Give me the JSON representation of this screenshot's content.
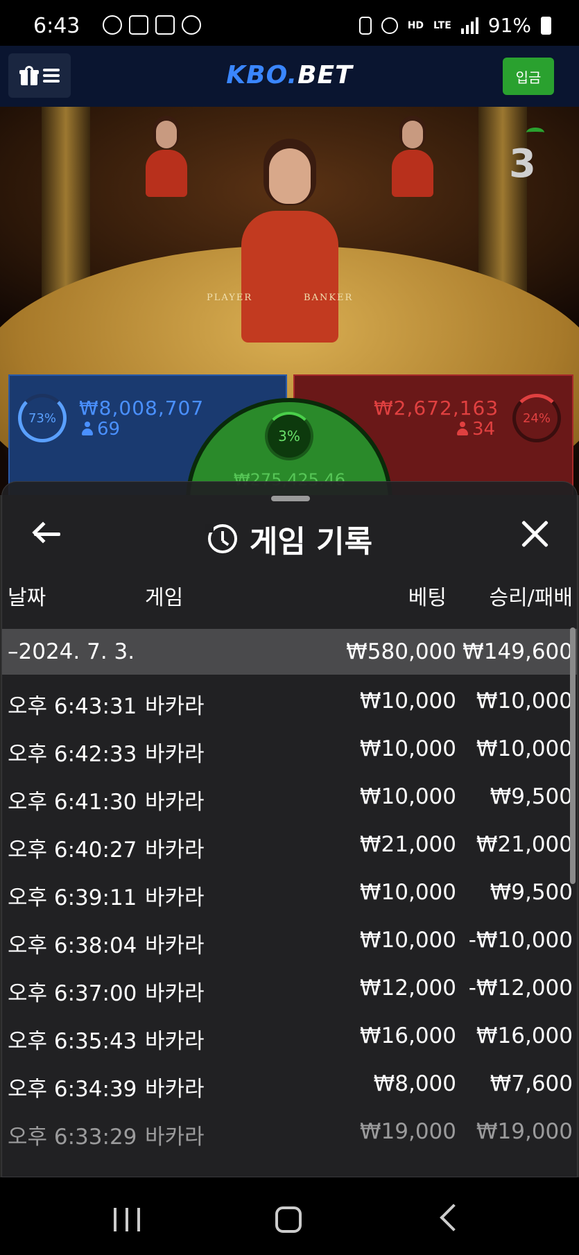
{
  "status_bar": {
    "time": "6:43",
    "hd": "HD",
    "voice": "VoLTE",
    "lte": "LTE",
    "battery": "91%"
  },
  "header": {
    "logo_main": "KBO.",
    "logo_accent": "BET",
    "deposit_label": "입금",
    "accent_color": "#3a86ff",
    "deposit_color": "#2aa12f"
  },
  "game": {
    "round_number": "3",
    "table_player_label": "PLAYER",
    "table_banker_label": "BANKER",
    "player": {
      "percent": "73%",
      "amount": "₩8,008,707",
      "count": "69"
    },
    "banker": {
      "percent": "24%",
      "amount": "₩2,672,163",
      "count": "34"
    },
    "tie": {
      "percent": "3%",
      "amount": "₩275,425.46"
    }
  },
  "sheet": {
    "title": "게임 기록",
    "columns": {
      "date": "날짜",
      "game": "게임",
      "bet": "베팅",
      "result": "승리/패배"
    },
    "summary": {
      "date": "–2024. 7. 3.",
      "bet": "₩580,000",
      "result": "₩149,600"
    },
    "rows": [
      {
        "time": "오후 6:43:31",
        "game": "바카라",
        "bet": "₩10,000",
        "result": "₩10,000"
      },
      {
        "time": "오후 6:42:33",
        "game": "바카라",
        "bet": "₩10,000",
        "result": "₩10,000"
      },
      {
        "time": "오후 6:41:30",
        "game": "바카라",
        "bet": "₩10,000",
        "result": "₩9,500"
      },
      {
        "time": "오후 6:40:27",
        "game": "바카라",
        "bet": "₩21,000",
        "result": "₩21,000"
      },
      {
        "time": "오후 6:39:11",
        "game": "바카라",
        "bet": "₩10,000",
        "result": "₩9,500"
      },
      {
        "time": "오후 6:38:04",
        "game": "바카라",
        "bet": "₩10,000",
        "result": "-₩10,000"
      },
      {
        "time": "오후 6:37:00",
        "game": "바카라",
        "bet": "₩12,000",
        "result": "-₩12,000"
      },
      {
        "time": "오후 6:35:43",
        "game": "바카라",
        "bet": "₩16,000",
        "result": "₩16,000"
      },
      {
        "time": "오후 6:34:39",
        "game": "바카라",
        "bet": "₩8,000",
        "result": "₩7,600"
      },
      {
        "time": "오후 6:33:29",
        "game": "바카라",
        "bet": "₩19,000",
        "result": "₩19,000"
      }
    ]
  },
  "icons": {
    "gift": "gift-icon",
    "menu": "hamburger-icon",
    "back": "arrow-left-icon",
    "history": "history-icon",
    "close": "close-icon"
  }
}
